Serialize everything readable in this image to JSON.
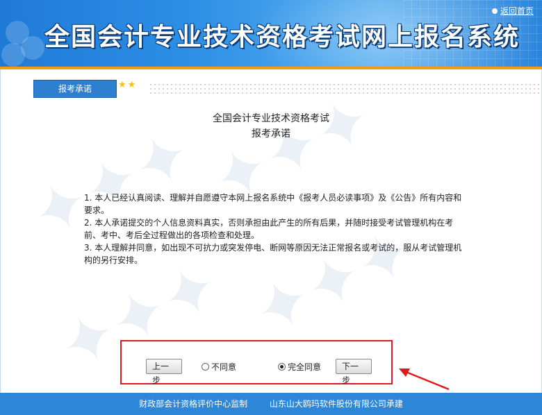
{
  "header": {
    "title": "全国会计专业技术资格考试网上报名系统",
    "home_link": "返回首页"
  },
  "section": {
    "tab_label": "报考承诺",
    "stars": "★★"
  },
  "content": {
    "heading_line1": "全国会计专业技术资格考试",
    "heading_line2": "报考承诺",
    "terms": [
      "1. 本人已经认真阅读、理解并自愿遵守本网上报名系统中《报考人员必读事项》及《公告》所有内容和要求。",
      "2. 本人承诺提交的个人信息资料真实，否则承担由此产生的所有后果，并随时接受考试管理机构在考前、考中、考后全过程做出的各项检查和处理。",
      "3. 本人理解并同意，如出现不可抗力或突发停电、断网等原因无法正常报名或考试的，服从考试管理机构的另行安排。"
    ]
  },
  "controls": {
    "prev_label": "上一步",
    "disagree_label": "不同意",
    "agree_label": "完全同意",
    "next_label": "下一步",
    "selected": "agree"
  },
  "footer": {
    "supervisor": "财政部会计资格评价中心监制",
    "developer": "山东山大鸥玛软件股份有限公司承建"
  },
  "colors": {
    "banner": "#2d8fe6",
    "accent_stripe": "#f39c12",
    "highlight_box": "#e0191e",
    "footer": "#2d86d8"
  }
}
